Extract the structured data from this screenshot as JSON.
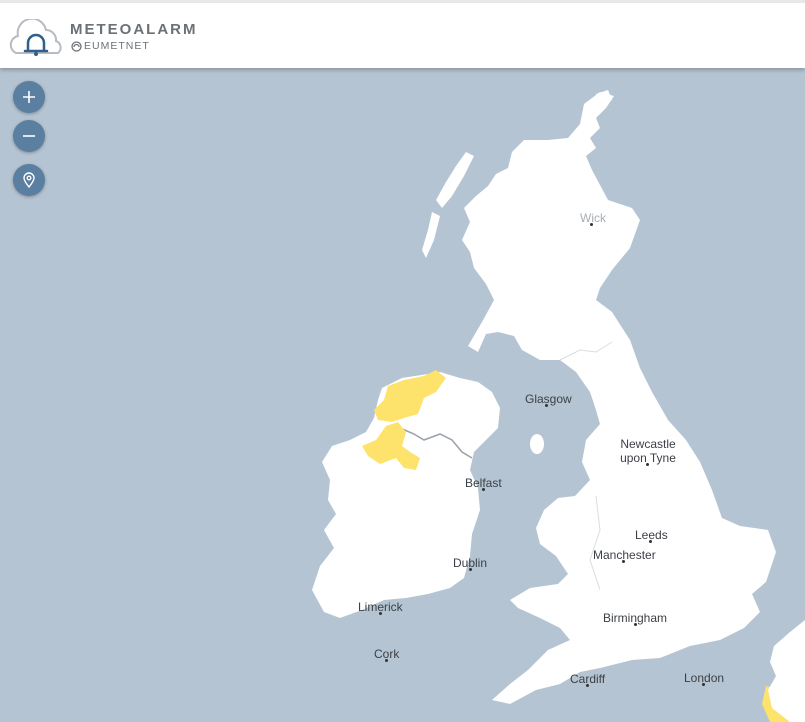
{
  "header": {
    "brand": "METEOALARM",
    "subbrand": "EUMETNET",
    "logo_icon": "cloud-bell-icon"
  },
  "controls": {
    "zoom_in_icon": "plus-icon",
    "zoom_out_icon": "minus-icon",
    "locate_icon": "location-pin-icon"
  },
  "map": {
    "sea_color": "#b5c4d2",
    "land_color": "#ffffff",
    "warning_yellow": "#fde26b",
    "cities": [
      {
        "name": "Wick"
      },
      {
        "name": "Glasgow"
      },
      {
        "name": "Newcastle upon Tyne"
      },
      {
        "name": "Belfast"
      },
      {
        "name": "Leeds"
      },
      {
        "name": "Manchester"
      },
      {
        "name": "Dublin"
      },
      {
        "name": "Limerick"
      },
      {
        "name": "Birmingham"
      },
      {
        "name": "Cork"
      },
      {
        "name": "Cardiff"
      },
      {
        "name": "London"
      }
    ]
  }
}
